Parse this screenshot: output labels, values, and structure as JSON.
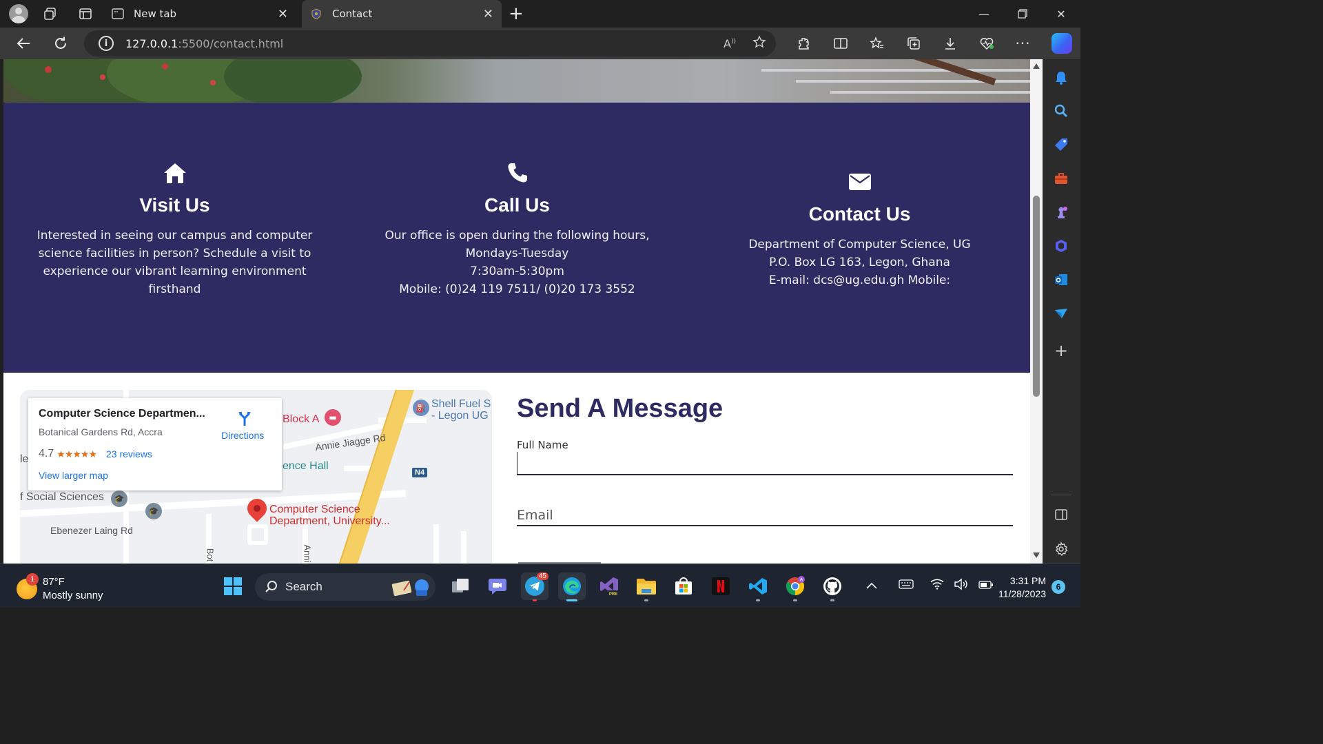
{
  "browser": {
    "tabs": [
      {
        "label": "New tab",
        "active": false
      },
      {
        "label": "Contact",
        "active": true
      }
    ],
    "url_host": "127.0.0.1",
    "url_path": ":5500/contact.html"
  },
  "page": {
    "info_cards": [
      {
        "icon": "home-icon",
        "title": "Visit Us",
        "lines": [
          "Interested in seeing our campus and computer",
          "science facilities in person? Schedule a visit to",
          "experience our vibrant learning environment",
          "firsthand"
        ]
      },
      {
        "icon": "phone-icon",
        "title": "Call Us",
        "lines": [
          "Our office is open during the following hours,",
          "Mondays-Tuesday",
          "7:30am-5:30pm",
          "Mobile: (0)24 119 7511/ (0)20 173 3552"
        ]
      },
      {
        "icon": "envelope-icon",
        "title": "Contact Us",
        "lines": [
          "Department of Computer Science, UG",
          "P.O. Box LG 163, Legon, Ghana",
          "E-mail: dcs@ug.edu.gh Mobile:"
        ]
      }
    ],
    "map": {
      "place_name": "Computer Science Departmen...",
      "address": "Botanical Gardens Rd, Accra",
      "rating": "4.7",
      "stars": "★★★★★",
      "reviews": "23 reviews",
      "view_larger": "View larger map",
      "directions": "Directions",
      "labels": {
        "block_a": "Block A",
        "shell_line1": "Shell Fuel S",
        "shell_line2": "- Legon UG",
        "annie_jiagge": "Annie Jiagge Rd",
        "ence_hall": "ence Hall",
        "le": "le",
        "social_sciences": "f Social Sciences",
        "pin_line1": "Computer Science",
        "pin_line2": "Department, University...",
        "ebenezer": "Ebenezer Laing Rd",
        "highway": "N4",
        "bot": "Bot",
        "anni": "Anni"
      }
    },
    "form": {
      "title": "Send A Message",
      "fullname_label": "Full Name",
      "fullname_value": "",
      "email_placeholder": "Email"
    }
  },
  "taskbar": {
    "weather_temp": "87°F",
    "weather_desc": "Mostly sunny",
    "weather_badge": "1",
    "search_placeholder": "Search",
    "telegram_badge": "45",
    "time": "3:31 PM",
    "date": "11/28/2023",
    "notifications": "6"
  },
  "colors": {
    "band": "#2d2b61",
    "accent": "#1a73e8"
  }
}
